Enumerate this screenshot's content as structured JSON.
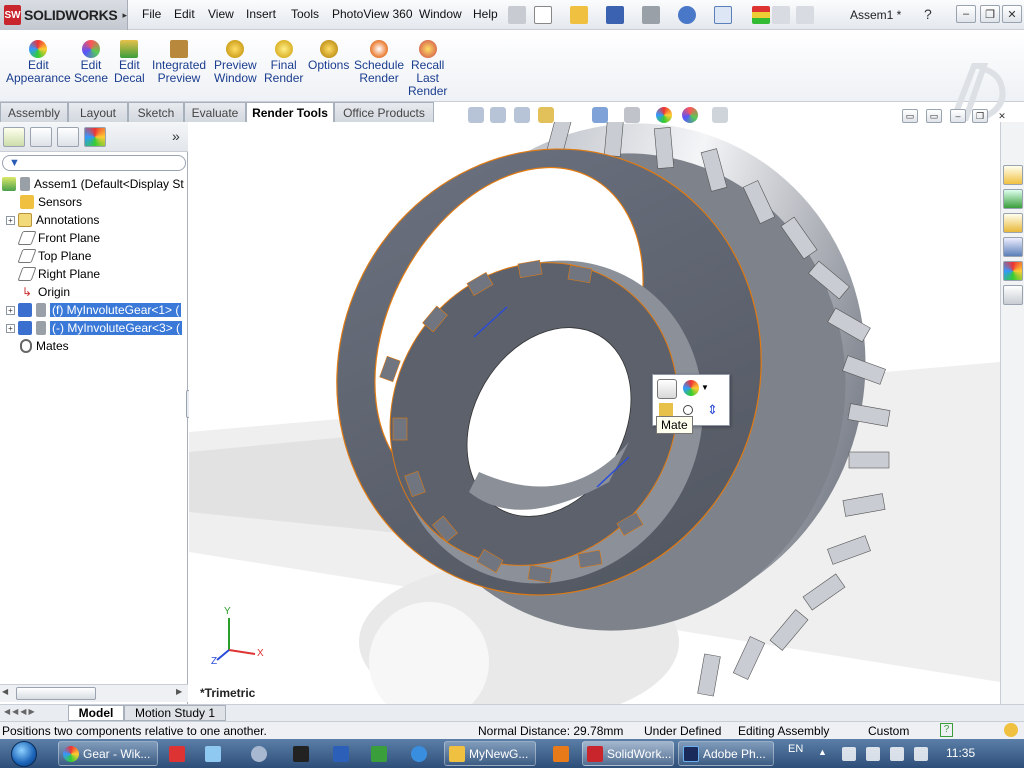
{
  "app": {
    "name": "SOLIDWORKS",
    "logo_text": "SW",
    "doc_title": "Assem1 *"
  },
  "menu": [
    "File",
    "Edit",
    "View",
    "Insert",
    "Tools",
    "PhotoView 360",
    "Window",
    "Help"
  ],
  "commands": [
    {
      "line1": "Edit",
      "line2": "Appearance",
      "line3": ""
    },
    {
      "line1": "Edit",
      "line2": "Scene",
      "line3": ""
    },
    {
      "line1": "Edit",
      "line2": "Decal",
      "line3": ""
    },
    {
      "line1": "Integrated",
      "line2": "Preview",
      "line3": ""
    },
    {
      "line1": "Preview",
      "line2": "Window",
      "line3": ""
    },
    {
      "line1": "Final",
      "line2": "Render",
      "line3": ""
    },
    {
      "line1": "Options",
      "line2": "",
      "line3": ""
    },
    {
      "line1": "Schedule",
      "line2": "Render",
      "line3": ""
    },
    {
      "line1": "Recall",
      "line2": "Last",
      "line3": "Render"
    }
  ],
  "tabs": [
    "Assembly",
    "Layout",
    "Sketch",
    "Evaluate",
    "Render Tools",
    "Office Products"
  ],
  "active_tab": "Render Tools",
  "tree": [
    {
      "label": "Assem1  (Default<Display St",
      "selected": false
    },
    {
      "label": "Sensors",
      "selected": false
    },
    {
      "label": "Annotations",
      "selected": false
    },
    {
      "label": "Front Plane",
      "selected": false
    },
    {
      "label": "Top Plane",
      "selected": false
    },
    {
      "label": "Right Plane",
      "selected": false
    },
    {
      "label": "Origin",
      "selected": false
    },
    {
      "label": "(f) MyInvoluteGear<1> (",
      "selected": true
    },
    {
      "label": "(-) MyInvoluteGear<3> (",
      "selected": true
    },
    {
      "label": "Mates",
      "selected": false
    }
  ],
  "panel": {
    "expand_glyph": "»",
    "collapse_glyph": "+"
  },
  "viewport": {
    "view_label": "*Trimetric",
    "axis_y": "Y",
    "axis_x": "X",
    "axis_z": "Z"
  },
  "popup": {
    "tooltip": "Mate"
  },
  "model_tabs": [
    "Model",
    "Motion Study 1"
  ],
  "status": {
    "message": "Positions two components relative to one another.",
    "distance": "Normal Distance: 29.78mm",
    "definition": "Under Defined",
    "mode": "Editing Assembly",
    "units": "Custom",
    "help_glyph": "?"
  },
  "taskbar": {
    "items": [
      {
        "label": "Gear - Wik...",
        "active": false
      },
      {
        "label": "MyNewG...",
        "active": false
      },
      {
        "label": "SolidWork...",
        "active": true
      },
      {
        "label": "Adobe Ph...",
        "active": false
      }
    ],
    "lang": "EN",
    "clock": "11:35"
  },
  "colors": {
    "accent": "#3a79d8",
    "gear": "#5e6472",
    "highlight": "#e07a12",
    "sw_red": "#c9252c"
  }
}
